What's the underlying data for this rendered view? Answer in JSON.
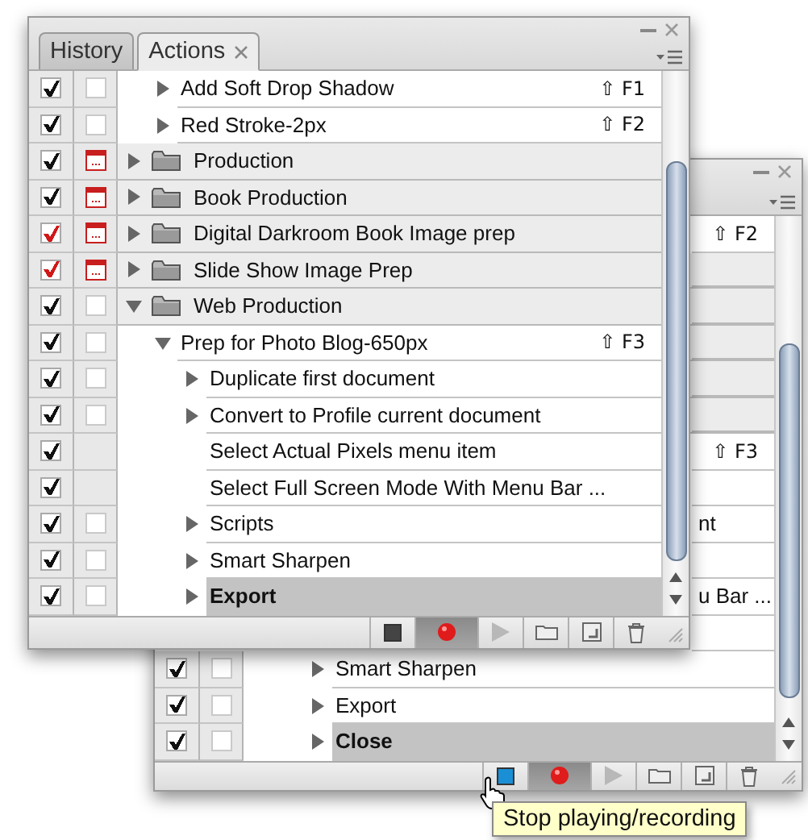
{
  "back_panel": {
    "rows": [
      {
        "children": [
          {
            "kind": "action",
            "shortcut": "⇧ F2",
            "selected": false
          }
        ]
      },
      {
        "kind": "set",
        "selected": false
      },
      {
        "kind": "set",
        "selected": false
      },
      {
        "kind": "set",
        "selected": false
      },
      {
        "kind": "set",
        "selected": false
      },
      {
        "kind": "set",
        "selected": false,
        "children": [
          {
            "kind": "action",
            "shortcut": "⇧ F3",
            "selected": false,
            "children": [
              {
                "kind": "action",
                "selected": false
              },
              {
                "kind": "action",
                "name_tail": "nt",
                "selected": false
              },
              {
                "kind": "action",
                "selected": false
              },
              {
                "kind": "action",
                "name_tail": "u Bar ...",
                "selected": false
              },
              {
                "kind": "action",
                "selected": false
              },
              {
                "kind": "action",
                "name": "Smart Sharpen",
                "checked": true,
                "color": "#111111",
                "dialog": false,
                "expanded": false,
                "selected": false
              },
              {
                "kind": "action",
                "name": "Export",
                "checked": true,
                "color": "#111111",
                "dialog": false,
                "expanded": false,
                "selected": false
              },
              {
                "kind": "action",
                "name": "Close",
                "checked": true,
                "color": "#111111",
                "dialog": false,
                "expanded": false,
                "selected": true
              }
            ]
          }
        ]
      }
    ],
    "toolbar": [
      {
        "kind": "stop",
        "on": false,
        "hovered": true
      },
      {
        "kind": "record",
        "on": true,
        "hovered": false
      },
      {
        "kind": "play",
        "on": false,
        "hovered": false
      },
      {
        "kind": "new_set",
        "on": false,
        "hovered": false
      },
      {
        "kind": "new_action",
        "on": false,
        "hovered": false
      },
      {
        "kind": "delete",
        "on": false,
        "hovered": false
      }
    ]
  },
  "front_panel": {
    "tabs": [
      {
        "label": "History",
        "selected": false
      },
      {
        "label": "Actions",
        "selected": true
      }
    ],
    "rows": [
      {
        "children": [
          {
            "kind": "action",
            "name": "Add Soft Drop Shadow",
            "shortcut": "⇧ F1",
            "checked": true,
            "color": "#111111",
            "dialog": false,
            "expanded": false,
            "selected": false
          },
          {
            "kind": "action",
            "name": "Red Stroke-2px",
            "shortcut": "⇧ F2",
            "checked": true,
            "color": "#111111",
            "dialog": false,
            "expanded": false,
            "selected": false
          }
        ]
      },
      {
        "kind": "set",
        "name": "Production",
        "checked": true,
        "color": "#111111",
        "dialog": true,
        "expanded": false,
        "selected": false
      },
      {
        "kind": "set",
        "name": "Book Production",
        "checked": true,
        "color": "#111111",
        "dialog": true,
        "expanded": false,
        "selected": false
      },
      {
        "kind": "set",
        "name": "Digital Darkroom Book Image prep",
        "checked": true,
        "color": "#d01818",
        "dialog": true,
        "expanded": false,
        "selected": false
      },
      {
        "kind": "set",
        "name": "Slide Show Image Prep",
        "checked": true,
        "color": "#d01818",
        "dialog": true,
        "expanded": false,
        "selected": false
      },
      {
        "kind": "set",
        "name": "Web Production",
        "checked": true,
        "color": "#111111",
        "dialog": false,
        "expanded": true,
        "selected": false,
        "children": [
          {
            "kind": "action",
            "name": "Prep for Photo Blog-650px",
            "shortcut": "⇧ F3",
            "checked": true,
            "color": "#111111",
            "dialog": false,
            "expanded": true,
            "selected": false,
            "children": [
              {
                "kind": "action",
                "name": "Duplicate first document",
                "checked": true,
                "color": "#111111",
                "dialog": false,
                "expanded": false,
                "selected": false
              },
              {
                "kind": "action",
                "name": "Convert to Profile current document",
                "checked": true,
                "color": "#111111",
                "dialog": false,
                "expanded": false,
                "selected": false
              },
              {
                "kind": "action",
                "name": "Select Actual Pixels menu item",
                "checked": true,
                "color": "#111111",
                "selected": false
              },
              {
                "kind": "action",
                "name": "Select Full Screen Mode With Menu Bar ...",
                "checked": true,
                "color": "#111111",
                "selected": false
              },
              {
                "kind": "action",
                "name": "Scripts",
                "checked": true,
                "color": "#111111",
                "dialog": false,
                "expanded": false,
                "selected": false
              },
              {
                "kind": "action",
                "name": "Smart Sharpen",
                "checked": true,
                "color": "#111111",
                "dialog": false,
                "expanded": false,
                "selected": false
              },
              {
                "kind": "action",
                "name": "Export",
                "checked": true,
                "color": "#111111",
                "dialog": false,
                "expanded": false,
                "selected": true
              }
            ]
          }
        ]
      }
    ],
    "toolbar": [
      {
        "kind": "stop",
        "on": false,
        "hovered": false
      },
      {
        "kind": "record",
        "on": true,
        "hovered": false
      },
      {
        "kind": "play",
        "on": false,
        "hovered": false
      },
      {
        "kind": "new_set",
        "on": false,
        "hovered": false
      },
      {
        "kind": "new_action",
        "on": false,
        "hovered": false
      },
      {
        "kind": "delete",
        "on": false,
        "hovered": false
      }
    ]
  },
  "tooltip": {
    "text": "Stop playing/recording"
  }
}
